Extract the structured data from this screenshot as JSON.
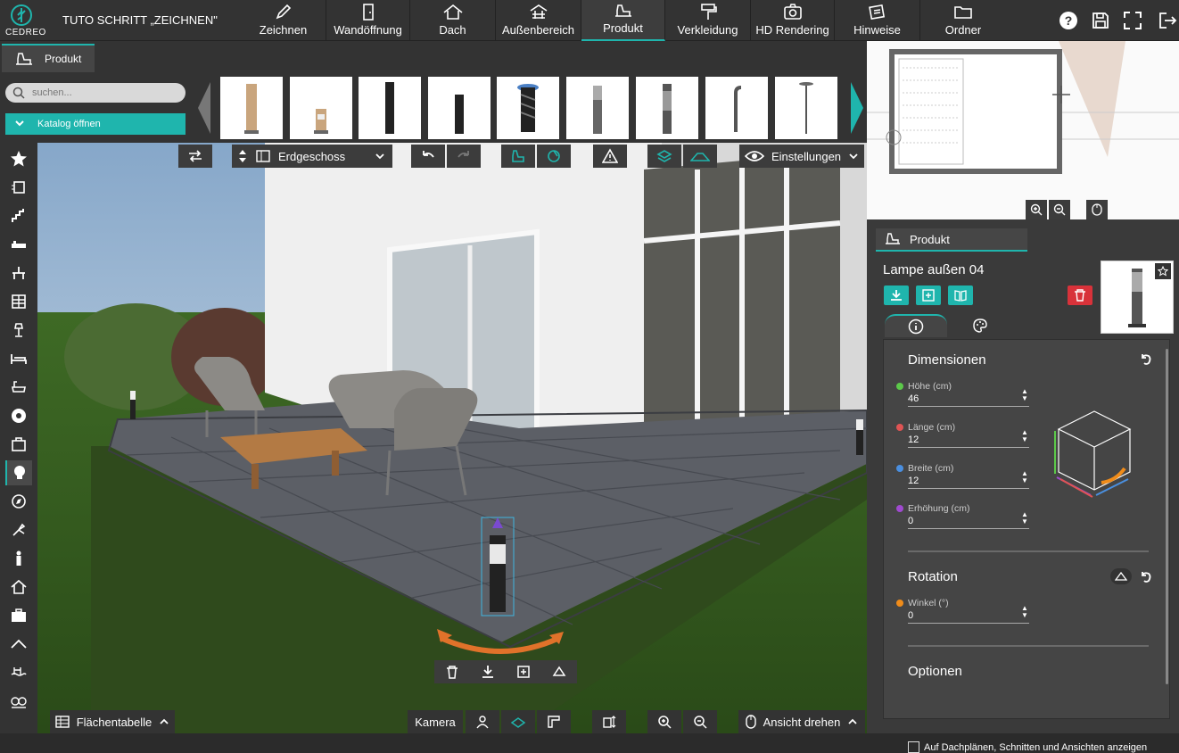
{
  "header": {
    "logo_text": "CEDREO",
    "project_title": "TUTO SCHRITT „ZEICHNEN\"",
    "nav": [
      {
        "label": "Zeichnen",
        "icon": "pencil-icon"
      },
      {
        "label": "Wandöffnung",
        "icon": "door-icon"
      },
      {
        "label": "Dach",
        "icon": "roof-icon"
      },
      {
        "label": "Außenbereich",
        "icon": "terrace-icon"
      },
      {
        "label": "Produkt",
        "icon": "armchair-icon"
      },
      {
        "label": "Verkleidung",
        "icon": "paint-roller-icon"
      },
      {
        "label": "HD Rendering",
        "icon": "camera-icon"
      },
      {
        "label": "Hinweise",
        "icon": "notes-icon"
      },
      {
        "label": "Ordner",
        "icon": "folder-icon"
      }
    ],
    "active_nav": "Produkt",
    "right_icons": [
      "help-icon",
      "save-icon",
      "fullscreen-icon",
      "exit-icon"
    ]
  },
  "tabs": {
    "product_tab": "Produkt"
  },
  "left_panel": {
    "search_placeholder": "suchen...",
    "catalog_button": "Katalog öffnen"
  },
  "toolbar": {
    "floor": "Erdgeschoss",
    "settings": "Einstellungen"
  },
  "bottom_bar": {
    "area_table": "Flächentabelle",
    "camera": "Kamera",
    "rotate_view": "Ansicht drehen"
  },
  "right_panel": {
    "tab": "Produkt",
    "product_name": "Lampe außen 04",
    "dimensions_title": "Dimensionen",
    "fields": [
      {
        "label": "Höhe (cm)",
        "value": "46",
        "color": "#5cc94a"
      },
      {
        "label": "Länge (cm)",
        "value": "12",
        "color": "#e05454"
      },
      {
        "label": "Breite (cm)",
        "value": "12",
        "color": "#4a8fe0"
      },
      {
        "label": "Erhöhung (cm)",
        "value": "0",
        "color": "#a04ad0"
      }
    ],
    "rotation_title": "Rotation",
    "angle": {
      "label": "Winkel (°)",
      "value": "0",
      "color": "#f08c1a"
    },
    "options_title": "Optionen",
    "option_checkbox": "Auf Dachplänen, Schnitten und Ansichten anzeigen"
  },
  "colors": {
    "accent": "#1fb5ad",
    "delete": "#d8323a",
    "dark": "#333333"
  }
}
